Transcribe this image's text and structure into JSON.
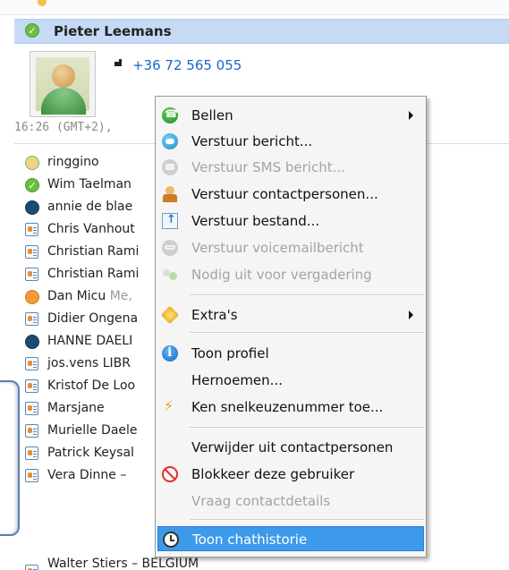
{
  "contact_header": {
    "name": "Pieter Leemans",
    "phone": "+36 72 565 055",
    "local_time": "16:26 (GMT+2),"
  },
  "contacts": [
    {
      "name": "ringgino",
      "mood": "",
      "status": "online-hands"
    },
    {
      "name": "Wim Taelman",
      "mood": "",
      "status": "online"
    },
    {
      "name": "annie de blae",
      "mood": "",
      "status": "skype-blue"
    },
    {
      "name": "Chris Vanhout",
      "mood": "",
      "status": "contact-card"
    },
    {
      "name": "Christian Rami",
      "mood": "",
      "status": "contact-card"
    },
    {
      "name": "Christian Rami",
      "mood": "",
      "status": "contact-card"
    },
    {
      "name": "Dan Micu",
      "mood": "Me,",
      "status": "away"
    },
    {
      "name": "Didier Ongena",
      "mood": "",
      "status": "contact-card"
    },
    {
      "name": "HANNE DAELI",
      "mood": "",
      "status": "skype-blue"
    },
    {
      "name": "jos.vens LIBR",
      "mood": "",
      "status": "contact-card"
    },
    {
      "name": "Kristof De Loo",
      "mood": "",
      "status": "contact-card"
    },
    {
      "name": "Marsjane",
      "mood": "",
      "status": "contact-card"
    },
    {
      "name": "Murielle Daele",
      "mood": "",
      "status": "contact-card"
    },
    {
      "name": "Patrick Keysal",
      "mood": "",
      "status": "contact-card"
    },
    {
      "name": "Vera Dinne –",
      "mood": "",
      "status": "contact-card"
    },
    {
      "name": "Walter Stiers – BELGIUM",
      "mood": "",
      "status": "contact-card"
    }
  ],
  "context_menu": {
    "items": [
      {
        "label": "Bellen",
        "icon": "call-icon",
        "enabled": true,
        "submenu": true
      },
      {
        "label": "Verstuur bericht...",
        "icon": "message-icon",
        "enabled": true
      },
      {
        "label": "Verstuur SMS bericht...",
        "icon": "sms-icon",
        "enabled": false
      },
      {
        "label": "Verstuur contactpersonen...",
        "icon": "send-contacts-icon",
        "enabled": true
      },
      {
        "label": "Verstuur bestand...",
        "icon": "send-file-icon",
        "enabled": true
      },
      {
        "label": "Verstuur voicemailbericht",
        "icon": "voicemail-icon",
        "enabled": false
      },
      {
        "label": "Nodig uit voor vergadering",
        "icon": "invite-icon",
        "enabled": false
      },
      {
        "label": "Extra's",
        "icon": "extras-icon",
        "enabled": true,
        "submenu": true
      },
      {
        "label": "Toon profiel",
        "icon": "info-icon",
        "enabled": true
      },
      {
        "label": "Hernoemen...",
        "icon": "",
        "enabled": true
      },
      {
        "label": "Ken snelkeuzenummer toe...",
        "icon": "speed-dial-icon",
        "enabled": true
      },
      {
        "label": "Verwijder uit contactpersonen",
        "icon": "",
        "enabled": true
      },
      {
        "label": "Blokkeer deze gebruiker",
        "icon": "block-icon",
        "enabled": true
      },
      {
        "label": "Vraag contactdetails",
        "icon": "",
        "enabled": false
      },
      {
        "label": "Toon chathistorie",
        "icon": "history-icon",
        "enabled": true,
        "selected": true
      }
    ]
  },
  "colors": {
    "selection": "#3d9aea",
    "header_bg": "#c6daf5",
    "link": "#1a66c9",
    "disabled_text": "#a3a3a3"
  }
}
